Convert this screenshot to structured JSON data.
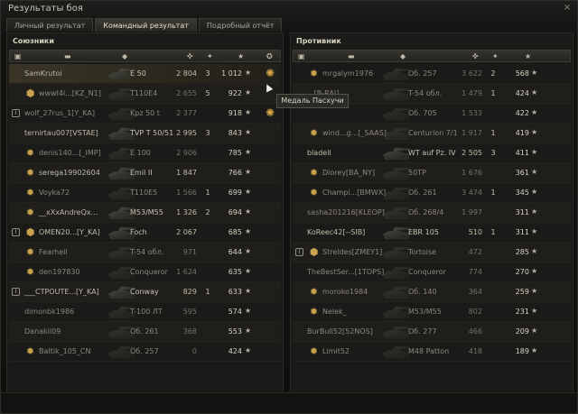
{
  "window": {
    "title": "Результаты боя",
    "close_label": "×"
  },
  "tabs": [
    {
      "label": "Личный результат",
      "active": false
    },
    {
      "label": "Командный результат",
      "active": true
    },
    {
      "label": "Подробный отчёт",
      "active": false
    }
  ],
  "columns": {
    "platoon_icon": "platoon-icon",
    "player_icon": "player-icon",
    "tank_icon": "tank-icon",
    "damage_icon": "damage-icon",
    "kills_icon": "kills-icon",
    "xp_icon": "xp-icon",
    "medal_icon": "medal-icon"
  },
  "allies": {
    "title": "Союзники",
    "rows": [
      {
        "platoon": "",
        "badge": "",
        "name": "SamKrutoi",
        "tank": "E 50",
        "damage": "2 804",
        "kills": "3",
        "xp": "1 012",
        "medal": "medal-icon",
        "dead": false,
        "me": true
      },
      {
        "platoon": "",
        "badge": "clan-icon",
        "name": "wwwl4i...[KZ_N1]",
        "tank": "T110E4",
        "damage": "2 655",
        "kills": "5",
        "xp": "922",
        "medal": "",
        "dead": true
      },
      {
        "platoon": "I",
        "badge": "",
        "name": "wolf_27rus_1[Y_KA]",
        "tank": "Kpz 50 t",
        "damage": "2 377",
        "kills": "",
        "xp": "918",
        "medal": "medal-icon",
        "dead": true
      },
      {
        "platoon": "",
        "badge": "",
        "name": "ternirtau007[VSTAE]",
        "tank": "TVP T 50/51",
        "damage": "2 995",
        "kills": "3",
        "xp": "843",
        "medal": "",
        "dead": false
      },
      {
        "platoon": "",
        "badge": "rank-icon",
        "name": "denis140...[_IMP]",
        "tank": "E 100",
        "damage": "2 906",
        "kills": "",
        "xp": "785",
        "medal": "",
        "dead": true
      },
      {
        "platoon": "",
        "badge": "rank-icon",
        "name": "serega19902604",
        "tank": "Emil II",
        "damage": "1 847",
        "kills": "",
        "xp": "766",
        "medal": "",
        "dead": false
      },
      {
        "platoon": "",
        "badge": "rank-icon",
        "name": "Voyka72",
        "tank": "T110E5",
        "damage": "1 566",
        "kills": "1",
        "xp": "699",
        "medal": "",
        "dead": true
      },
      {
        "platoon": "",
        "badge": "rank-icon",
        "name": "__xXxAndreQx...",
        "tank": "M53/M55",
        "damage": "1 326",
        "kills": "2",
        "xp": "694",
        "medal": "",
        "dead": false
      },
      {
        "platoon": "I",
        "badge": "clan-icon",
        "name": "OMEN20...[Y_KA]",
        "tank": "Foch",
        "damage": "2 067",
        "kills": "",
        "xp": "685",
        "medal": "",
        "dead": false
      },
      {
        "platoon": "",
        "badge": "rank-icon",
        "name": "Fearhell",
        "tank": "T-54 обл.",
        "damage": "971",
        "kills": "",
        "xp": "644",
        "medal": "",
        "dead": true
      },
      {
        "platoon": "",
        "badge": "rank-icon",
        "name": "den197830",
        "tank": "Conqueror",
        "damage": "1 624",
        "kills": "",
        "xp": "635",
        "medal": "",
        "dead": true
      },
      {
        "platoon": "I",
        "badge": "",
        "name": "___CTPOUTE...[Y_KA]",
        "tank": "Conway",
        "damage": "829",
        "kills": "1",
        "xp": "633",
        "medal": "",
        "dead": false
      },
      {
        "platoon": "",
        "badge": "",
        "name": "dimonbk1986",
        "tank": "T-100 ЛТ",
        "damage": "595",
        "kills": "",
        "xp": "574",
        "medal": "",
        "dead": true
      },
      {
        "platoon": "",
        "badge": "",
        "name": "Danakil09",
        "tank": "Об. 261",
        "damage": "368",
        "kills": "",
        "xp": "553",
        "medal": "",
        "dead": true
      },
      {
        "platoon": "",
        "badge": "rank-icon",
        "name": "Baltik_105_CN",
        "tank": "Об. 257",
        "damage": "0",
        "kills": "",
        "xp": "424",
        "medal": "",
        "dead": true
      }
    ]
  },
  "enemies": {
    "title": "Противник",
    "rows": [
      {
        "platoon": "",
        "badge": "rank-icon",
        "name": "mrgalym1976",
        "tank": "Об. 257",
        "damage": "3 622",
        "kills": "2",
        "xp": "568",
        "dead": true
      },
      {
        "platoon": "",
        "badge": "",
        "name": "...[B-RAI]",
        "tank": "T-54 обл.",
        "damage": "1 479",
        "kills": "1",
        "xp": "424",
        "dead": true
      },
      {
        "platoon": "",
        "badge": "",
        "name": "",
        "tank": "Об. 705",
        "damage": "1 533",
        "kills": "",
        "xp": "422",
        "dead": true
      },
      {
        "platoon": "",
        "badge": "rank-icon",
        "name": "wind...g...[_SAAS]",
        "tank": "Centurion 7/1",
        "damage": "1 917",
        "kills": "1",
        "xp": "419",
        "dead": true
      },
      {
        "platoon": "",
        "badge": "",
        "name": "bladell",
        "tank": "WT auf Pz. IV",
        "damage": "2 505",
        "kills": "3",
        "xp": "411",
        "dead": false
      },
      {
        "platoon": "",
        "badge": "rank-icon",
        "name": "Diorey[BA_NY]",
        "tank": "50TP",
        "damage": "1 676",
        "kills": "",
        "xp": "361",
        "dead": true
      },
      {
        "platoon": "",
        "badge": "rank-icon",
        "name": "Champi...[BMWX]",
        "tank": "Об. 261",
        "damage": "3 474",
        "kills": "1",
        "xp": "345",
        "dead": true
      },
      {
        "platoon": "",
        "badge": "",
        "name": "sasha201216[KLEOP]",
        "tank": "Об. 268/4",
        "damage": "1 997",
        "kills": "",
        "xp": "311",
        "dead": true
      },
      {
        "platoon": "",
        "badge": "",
        "name": "KoReec42[--SIB]",
        "tank": "EBR 105",
        "damage": "510",
        "kills": "1",
        "xp": "311",
        "dead": false
      },
      {
        "platoon": "I",
        "badge": "clan-icon",
        "name": "Streldes[ZMEY1]",
        "tank": "Tortoise",
        "damage": "472",
        "kills": "",
        "xp": "285",
        "dead": true
      },
      {
        "platoon": "",
        "badge": "",
        "name": "TheBestSer...[1TOPS]",
        "tank": "Conqueror",
        "damage": "774",
        "kills": "",
        "xp": "270",
        "dead": true
      },
      {
        "platoon": "",
        "badge": "rank-icon",
        "name": "moroko1984",
        "tank": "Об. 140",
        "damage": "364",
        "kills": "",
        "xp": "259",
        "dead": true
      },
      {
        "platoon": "",
        "badge": "rank-icon",
        "name": "Nelek_",
        "tank": "M53/M55",
        "damage": "802",
        "kills": "",
        "xp": "231",
        "dead": true
      },
      {
        "platoon": "",
        "badge": "",
        "name": "BurBull52[52NOS]",
        "tank": "Об. 277",
        "damage": "466",
        "kills": "",
        "xp": "209",
        "dead": true
      },
      {
        "platoon": "",
        "badge": "rank-icon",
        "name": "Limit52",
        "tank": "M48 Patton",
        "damage": "418",
        "kills": "",
        "xp": "189",
        "dead": true
      }
    ]
  },
  "tooltip": {
    "text": "Медаль Пасхучи"
  }
}
